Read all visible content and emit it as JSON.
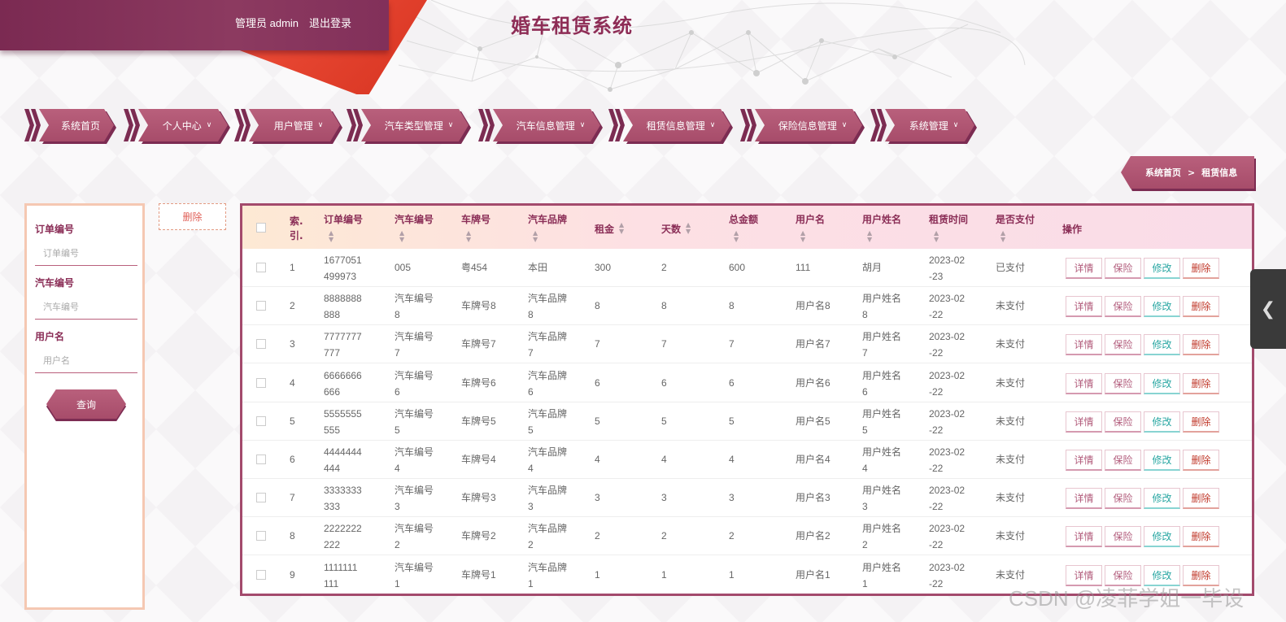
{
  "header": {
    "user_text": "管理员 admin",
    "logout": "退出登录",
    "title": "婚车租赁系统"
  },
  "nav": [
    {
      "label": "系统首页",
      "dropdown": false
    },
    {
      "label": "个人中心",
      "dropdown": true
    },
    {
      "label": "用户管理",
      "dropdown": true
    },
    {
      "label": "汽车类型管理",
      "dropdown": true
    },
    {
      "label": "汽车信息管理",
      "dropdown": true
    },
    {
      "label": "租赁信息管理",
      "dropdown": true
    },
    {
      "label": "保险信息管理",
      "dropdown": true
    },
    {
      "label": "系统管理",
      "dropdown": true
    }
  ],
  "breadcrumb": {
    "home": "系统首页",
    "sep": ">",
    "current": "租赁信息"
  },
  "search": {
    "order_label": "订单编号",
    "order_placeholder": "订单编号",
    "car_label": "汽车编号",
    "car_placeholder": "汽车编号",
    "user_label": "用户名",
    "user_placeholder": "用户名",
    "query": "查询"
  },
  "delete_button": "删除",
  "table": {
    "headers": {
      "index": "索.引.",
      "order_no": "订单编号",
      "car_no": "汽车编号",
      "plate": "车牌号",
      "brand": "汽车品牌",
      "rent": "租金",
      "days": "天数",
      "total": "总金额",
      "username": "用户名",
      "realname": "用户姓名",
      "time": "租赁时间",
      "paid": "是否支付",
      "ops": "操作"
    },
    "actions": {
      "detail": "详情",
      "insurance": "保险",
      "edit": "修改",
      "delete": "删除"
    },
    "rows": [
      {
        "idx": "1",
        "order": [
          "1677051",
          "499973"
        ],
        "car": [
          "005"
        ],
        "plate": "粤454",
        "brand": [
          "本田"
        ],
        "rent": "300",
        "days": "2",
        "total": "600",
        "user": "111",
        "name": [
          "胡月"
        ],
        "time": [
          "2023-02",
          "-23"
        ],
        "paid": "已支付"
      },
      {
        "idx": "2",
        "order": [
          "8888888",
          "888"
        ],
        "car": [
          "汽车编号",
          "8"
        ],
        "plate": "车牌号8",
        "brand": [
          "汽车品牌",
          "8"
        ],
        "rent": "8",
        "days": "8",
        "total": "8",
        "user": "用户名8",
        "name": [
          "用户姓名",
          "8"
        ],
        "time": [
          "2023-02",
          "-22"
        ],
        "paid": "未支付"
      },
      {
        "idx": "3",
        "order": [
          "7777777",
          "777"
        ],
        "car": [
          "汽车编号",
          "7"
        ],
        "plate": "车牌号7",
        "brand": [
          "汽车品牌",
          "7"
        ],
        "rent": "7",
        "days": "7",
        "total": "7",
        "user": "用户名7",
        "name": [
          "用户姓名",
          "7"
        ],
        "time": [
          "2023-02",
          "-22"
        ],
        "paid": "未支付"
      },
      {
        "idx": "4",
        "order": [
          "6666666",
          "666"
        ],
        "car": [
          "汽车编号",
          "6"
        ],
        "plate": "车牌号6",
        "brand": [
          "汽车品牌",
          "6"
        ],
        "rent": "6",
        "days": "6",
        "total": "6",
        "user": "用户名6",
        "name": [
          "用户姓名",
          "6"
        ],
        "time": [
          "2023-02",
          "-22"
        ],
        "paid": "未支付"
      },
      {
        "idx": "5",
        "order": [
          "5555555",
          "555"
        ],
        "car": [
          "汽车编号",
          "5"
        ],
        "plate": "车牌号5",
        "brand": [
          "汽车品牌",
          "5"
        ],
        "rent": "5",
        "days": "5",
        "total": "5",
        "user": "用户名5",
        "name": [
          "用户姓名",
          "5"
        ],
        "time": [
          "2023-02",
          "-22"
        ],
        "paid": "未支付"
      },
      {
        "idx": "6",
        "order": [
          "4444444",
          "444"
        ],
        "car": [
          "汽车编号",
          "4"
        ],
        "plate": "车牌号4",
        "brand": [
          "汽车品牌",
          "4"
        ],
        "rent": "4",
        "days": "4",
        "total": "4",
        "user": "用户名4",
        "name": [
          "用户姓名",
          "4"
        ],
        "time": [
          "2023-02",
          "-22"
        ],
        "paid": "未支付"
      },
      {
        "idx": "7",
        "order": [
          "3333333",
          "333"
        ],
        "car": [
          "汽车编号",
          "3"
        ],
        "plate": "车牌号3",
        "brand": [
          "汽车品牌",
          "3"
        ],
        "rent": "3",
        "days": "3",
        "total": "3",
        "user": "用户名3",
        "name": [
          "用户姓名",
          "3"
        ],
        "time": [
          "2023-02",
          "-22"
        ],
        "paid": "未支付"
      },
      {
        "idx": "8",
        "order": [
          "2222222",
          "222"
        ],
        "car": [
          "汽车编号",
          "2"
        ],
        "plate": "车牌号2",
        "brand": [
          "汽车品牌",
          "2"
        ],
        "rent": "2",
        "days": "2",
        "total": "2",
        "user": "用户名2",
        "name": [
          "用户姓名",
          "2"
        ],
        "time": [
          "2023-02",
          "-22"
        ],
        "paid": "未支付"
      },
      {
        "idx": "9",
        "order": [
          "1111111",
          "111"
        ],
        "car": [
          "汽车编号",
          "1"
        ],
        "plate": "车牌号1",
        "brand": [
          "汽车品牌",
          "1"
        ],
        "rent": "1",
        "days": "1",
        "total": "1",
        "user": "用户名1",
        "name": [
          "用户姓名",
          "1"
        ],
        "time": [
          "2023-02",
          "-22"
        ],
        "paid": "未支付"
      }
    ]
  },
  "side_tab_icon": "chevron-left-icon",
  "watermark": "CSDN @凌菲学姐一毕设",
  "colors": {
    "brand": "#8e2d56",
    "accent_red": "#e8432f",
    "nav_pink": "#b15a7a",
    "edit_teal": "#2aa7a3"
  }
}
